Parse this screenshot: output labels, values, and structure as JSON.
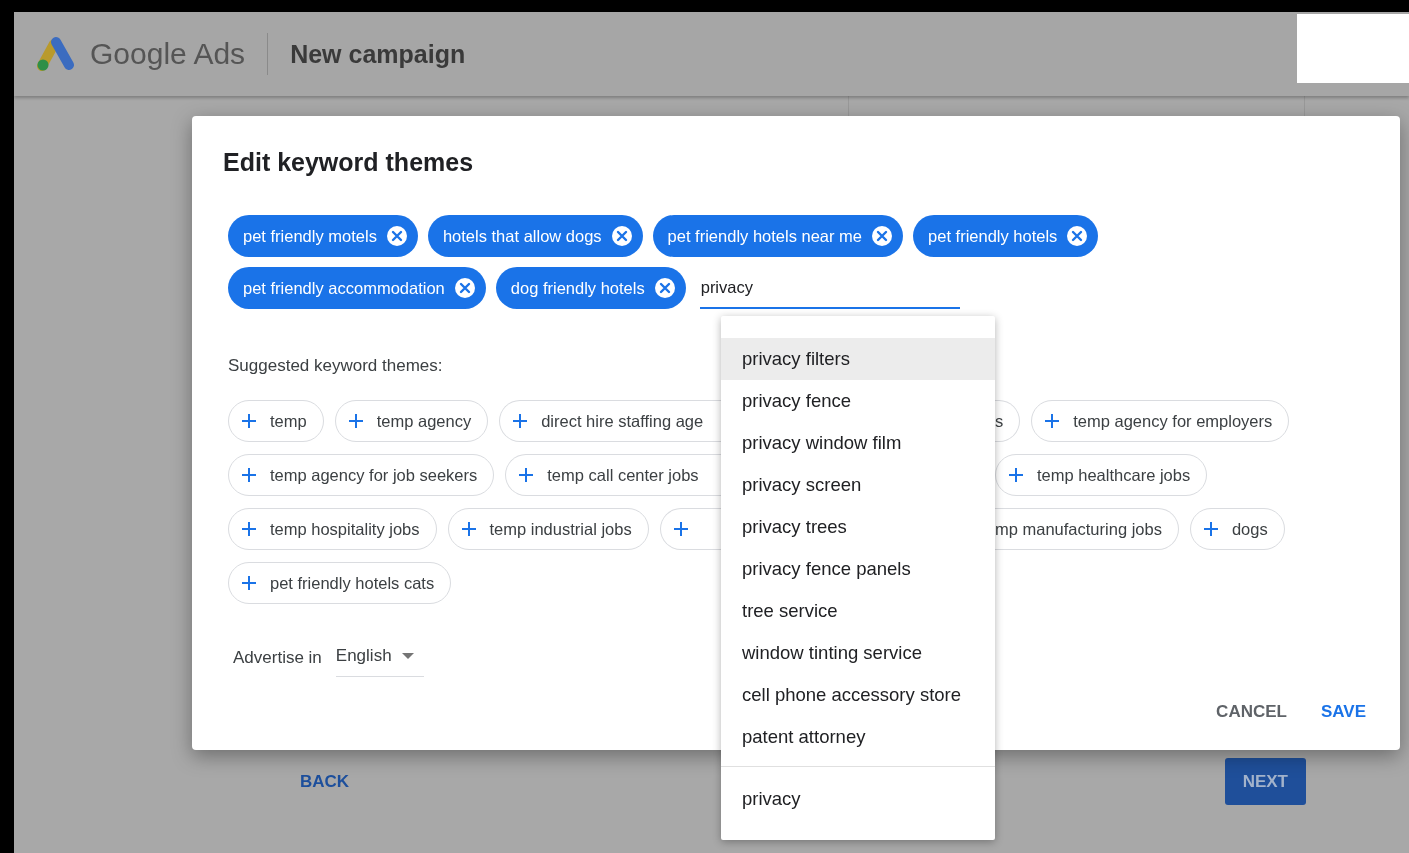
{
  "header": {
    "product": "Google Ads",
    "page_title": "New campaign"
  },
  "footer_buttons": [
    {
      "label": "BACK",
      "kind": "text"
    },
    {
      "label": "NEXT",
      "kind": "filled"
    }
  ],
  "dialog": {
    "title": "Edit keyword themes",
    "selected_themes": [
      "pet friendly motels",
      "hotels that allow dogs",
      "pet friendly hotels near me",
      "pet friendly hotels",
      "pet friendly accommodation",
      "dog friendly hotels"
    ],
    "input": {
      "value": "privacy"
    },
    "suggestions": [
      {
        "label": "privacy filters",
        "selected": true
      },
      {
        "label": "privacy fence",
        "selected": false
      },
      {
        "label": "privacy window film",
        "selected": false
      },
      {
        "label": "privacy screen",
        "selected": false
      },
      {
        "label": "privacy trees",
        "selected": false
      },
      {
        "label": "privacy fence panels",
        "selected": false
      },
      {
        "label": "tree service",
        "selected": false
      },
      {
        "label": "window tinting service",
        "selected": false
      },
      {
        "label": "cell phone accessory store",
        "selected": false
      },
      {
        "label": "patent attorney",
        "selected": false
      }
    ],
    "custom_suggestion": "privacy",
    "suggested_label": "Suggested keyword themes:",
    "suggested_rows": [
      [
        {
          "label": "temp",
          "kind": "full"
        },
        {
          "label": "temp agency",
          "kind": "full"
        },
        {
          "label": "direct hire staffing age",
          "kind": "cut_right"
        },
        {
          "label": "s",
          "kind": "cut_left"
        },
        {
          "label": "temp agency for employers",
          "kind": "full"
        }
      ],
      [
        {
          "label": "temp agency for job seekers",
          "kind": "full"
        },
        {
          "label": "temp call center jobs",
          "kind": "cut_right"
        },
        {
          "label": "temp healthcare jobs",
          "kind": "full"
        }
      ],
      [
        {
          "label": "temp hospitality jobs",
          "kind": "full"
        },
        {
          "label": "temp industrial jobs",
          "kind": "full"
        },
        {
          "kind": "covered"
        },
        {
          "label": "mp manufacturing jobs",
          "kind": "cut_left"
        },
        {
          "label": "dogs",
          "kind": "full"
        }
      ],
      [
        {
          "label": "pet friendly hotels cats",
          "kind": "full"
        }
      ]
    ],
    "language": {
      "label": "Advertise in",
      "value": "English"
    },
    "actions": [
      {
        "label": "CANCEL",
        "kind": "secondary"
      },
      {
        "label": "SAVE",
        "kind": "primary"
      }
    ]
  }
}
